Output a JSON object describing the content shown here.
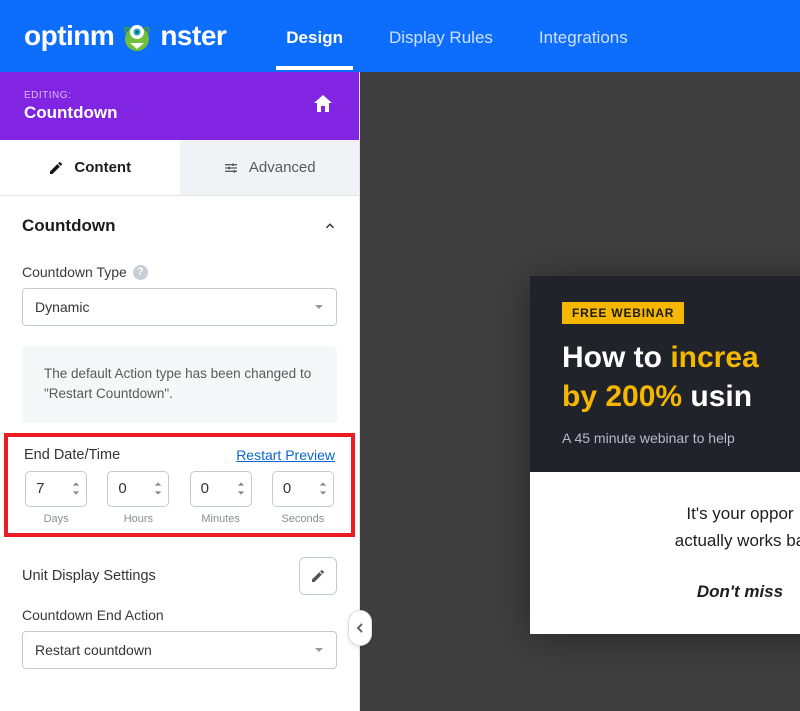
{
  "header": {
    "logo_prefix": "optinm",
    "logo_suffix": "nster",
    "tabs": [
      {
        "label": "Design",
        "active": true
      },
      {
        "label": "Display Rules",
        "active": false
      },
      {
        "label": "Integrations",
        "active": false
      }
    ]
  },
  "editing": {
    "label": "EDITING:",
    "title": "Countdown"
  },
  "panel_tabs": {
    "content": "Content",
    "advanced": "Advanced"
  },
  "section": {
    "title": "Countdown"
  },
  "countdown_type": {
    "label": "Countdown Type",
    "value": "Dynamic"
  },
  "info_message": "The default Action type has been changed to \"Restart Countdown\".",
  "end_datetime": {
    "label": "End Date/Time",
    "restart": "Restart Preview",
    "units": [
      {
        "value": "7",
        "caption": "Days"
      },
      {
        "value": "0",
        "caption": "Hours"
      },
      {
        "value": "0",
        "caption": "Minutes"
      },
      {
        "value": "0",
        "caption": "Seconds"
      }
    ]
  },
  "unit_display": {
    "label": "Unit Display Settings"
  },
  "end_action": {
    "label": "Countdown End Action",
    "value": "Restart countdown"
  },
  "preview": {
    "badge": "FREE WEBINAR",
    "title_1": "How to ",
    "title_accent1": "increa",
    "title_2": "by 200%",
    "title_plain2": " usin",
    "subtitle": "A 45 minute webinar to help",
    "body": "It's your oppor",
    "body2": "actually works ba",
    "miss": "Don't miss "
  }
}
